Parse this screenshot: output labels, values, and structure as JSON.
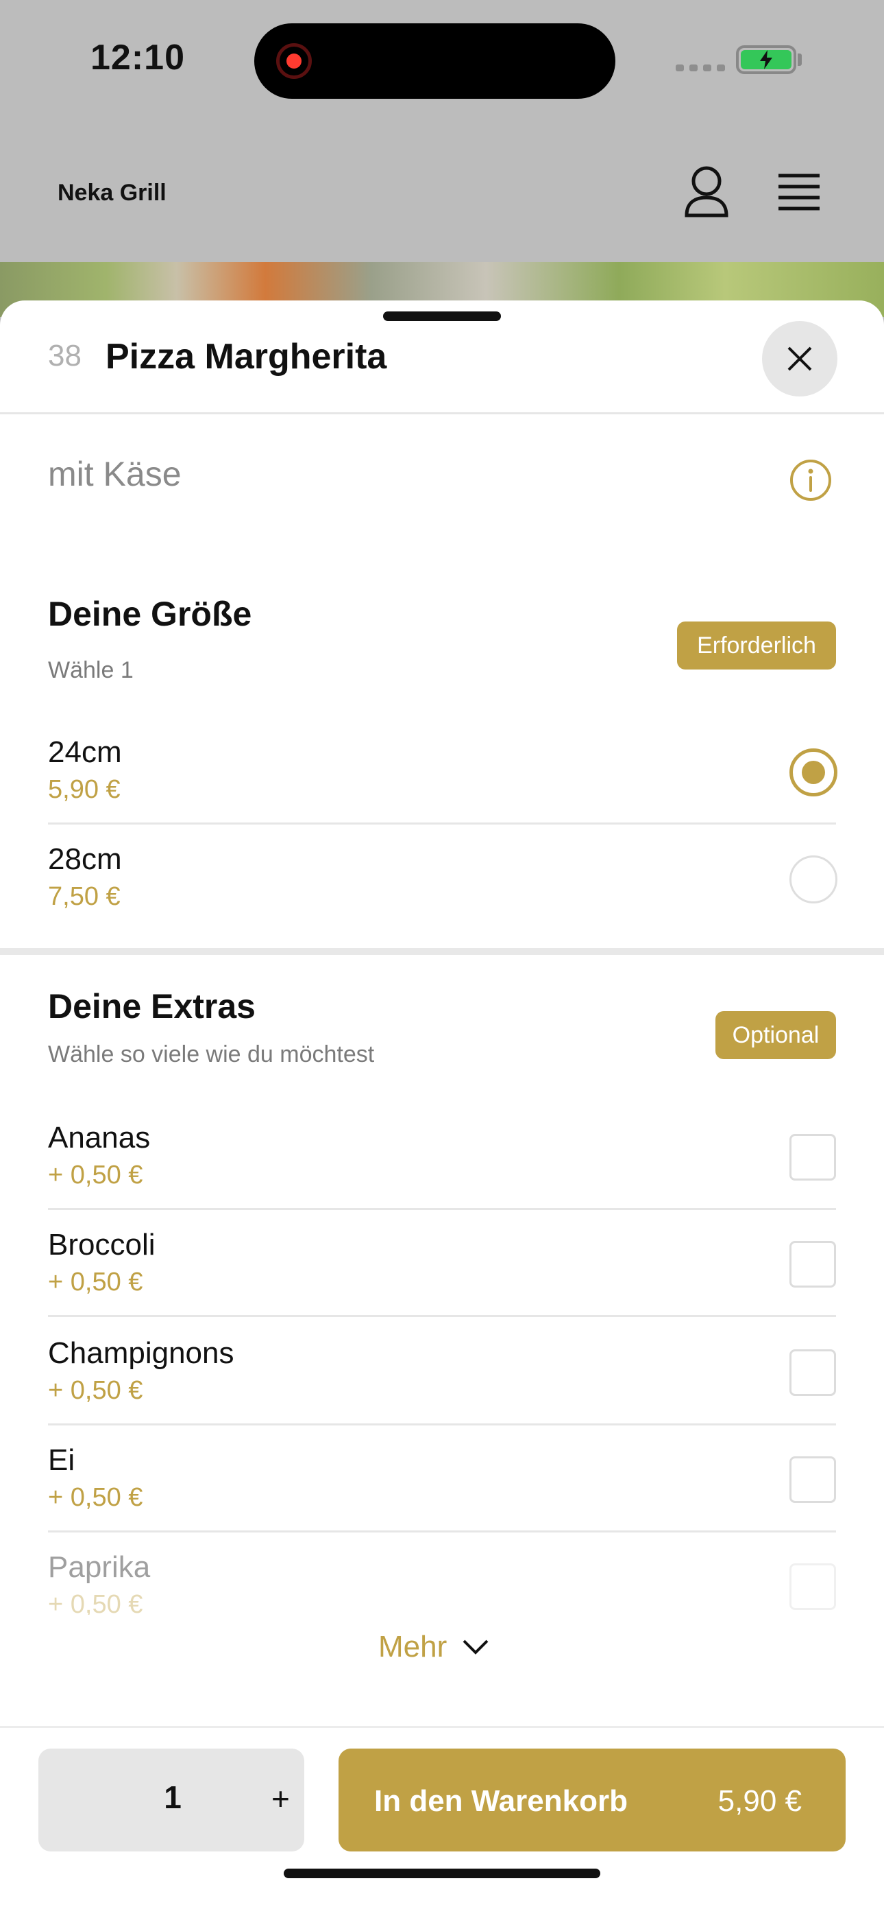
{
  "status_bar": {
    "time": "12:10"
  },
  "app_header": {
    "brand": "Neka Grill"
  },
  "item": {
    "number": "38",
    "title": "Pizza Margherita",
    "description": "mit Käse"
  },
  "sections": [
    {
      "title": "Deine Größe",
      "subtitle": "Wähle 1",
      "badge": "Erforderlich",
      "options": [
        {
          "name": "24cm",
          "price": "5,90 €",
          "selected": true
        },
        {
          "name": "28cm",
          "price": "7,50 €",
          "selected": false
        }
      ]
    },
    {
      "title": "Deine Extras",
      "subtitle": "Wähle so viele wie du möchtest",
      "badge": "Optional",
      "options": [
        {
          "name": "Ananas",
          "price": "+ 0,50 €",
          "checked": false
        },
        {
          "name": "Broccoli",
          "price": "+ 0,50 €",
          "checked": false
        },
        {
          "name": "Champignons",
          "price": "+ 0,50 €",
          "checked": false
        },
        {
          "name": "Ei",
          "price": "+ 0,50 €",
          "checked": false
        },
        {
          "name": "Paprika",
          "price": "+ 0,50 €",
          "checked": false
        }
      ]
    }
  ],
  "more_label": "Mehr",
  "footer": {
    "quantity": "1",
    "plus": "+",
    "cart_label": "In den Warenkorb",
    "cart_price": "5,90 €"
  },
  "colors": {
    "accent": "#c0a145",
    "overlay": "#bcbcbc",
    "battery": "#34c759",
    "record": "#ff3b30"
  }
}
